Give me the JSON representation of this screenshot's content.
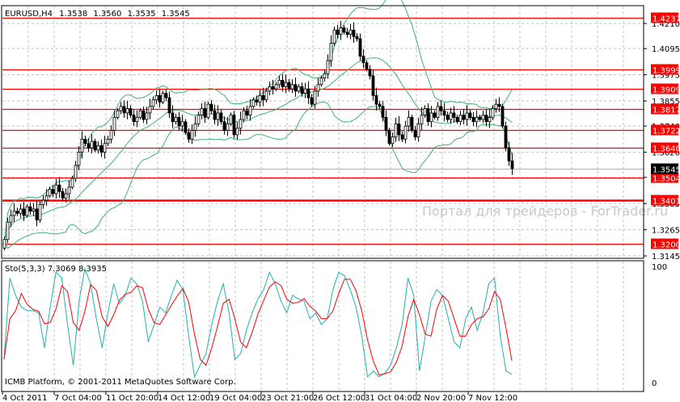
{
  "header": {
    "symbol": "EURUSD,H4",
    "open": "1.3538",
    "high": "1.3560",
    "low": "1.3535",
    "close": "1.3545"
  },
  "watermark": "Портал для трейдеров - ForTrader.ru",
  "indicator_label": "Sto(5,3,3) 7.3069 8.3935",
  "copyright": "ICMB Platform, © 2001-2011 MetaQuotes Software Corp.",
  "colors": {
    "level": "#ff0000",
    "band": "#3cb371",
    "sto_main": "#20b2aa",
    "sto_signal": "#ff0000",
    "bid": "#000000",
    "grid": "#c0c0c0"
  },
  "chart_data": {
    "type": "candlestick",
    "title": "EURUSD,H4",
    "ylim": [
      1.3134,
      1.4288
    ],
    "y_ticks": [
      "1.4210",
      "1.4095",
      "1.3975",
      "1.3855",
      "1.3740",
      "1.3620",
      "1.3505",
      "1.3385",
      "1.3265",
      "1.3145"
    ],
    "x_ticks": [
      "4 Oct 2011",
      "7 Oct 04:00",
      "11 Oct 20:00",
      "14 Oct 12:00",
      "19 Oct 04:00",
      "23 Oct 21:00",
      "26 Oct 12:00",
      "31 Oct 04:00",
      "2 Nov 20:00",
      "7 Nov 12:00"
    ],
    "levels": [
      "1.4237",
      "1.3999",
      "1.3909",
      "1.3817",
      "1.3722",
      "1.3640",
      "1.3504",
      "1.3401",
      "1.3200"
    ],
    "bid": "1.3545",
    "closes": [
      1.322,
      1.33,
      1.333,
      1.335,
      1.334,
      1.336,
      1.333,
      1.337,
      1.335,
      1.336,
      1.331,
      1.338,
      1.34,
      1.342,
      1.345,
      1.343,
      1.347,
      1.344,
      1.341,
      1.343,
      1.346,
      1.35,
      1.356,
      1.362,
      1.368,
      1.366,
      1.364,
      1.367,
      1.363,
      1.365,
      1.362,
      1.366,
      1.368,
      1.372,
      1.378,
      1.381,
      1.383,
      1.38,
      1.382,
      1.379,
      1.376,
      1.378,
      1.381,
      1.377,
      1.38,
      1.383,
      1.386,
      1.388,
      1.385,
      1.389,
      1.387,
      1.38,
      1.376,
      1.378,
      1.374,
      1.376,
      1.371,
      1.368,
      1.372,
      1.375,
      1.379,
      1.382,
      1.378,
      1.384,
      1.381,
      1.377,
      1.38,
      1.376,
      1.372,
      1.375,
      1.379,
      1.37,
      1.373,
      1.377,
      1.381,
      1.379,
      1.383,
      1.386,
      1.385,
      1.388,
      1.386,
      1.39,
      1.392,
      1.391,
      1.393,
      1.395,
      1.392,
      1.394,
      1.391,
      1.393,
      1.39,
      1.392,
      1.389,
      1.391,
      1.387,
      1.384,
      1.39,
      1.393,
      1.396,
      1.398,
      1.404,
      1.412,
      1.418,
      1.416,
      1.419,
      1.417,
      1.416,
      1.418,
      1.415,
      1.414,
      1.406,
      1.403,
      1.4,
      1.397,
      1.388,
      1.384,
      1.383,
      1.378,
      1.372,
      1.366,
      1.369,
      1.375,
      1.37,
      1.368,
      1.374,
      1.378,
      1.372,
      1.369,
      1.375,
      1.379,
      1.382,
      1.376,
      1.38,
      1.378,
      1.383,
      1.381,
      1.379,
      1.377,
      1.38,
      1.378,
      1.376,
      1.379,
      1.377,
      1.38,
      1.378,
      1.376,
      1.378,
      1.377,
      1.379,
      1.376,
      1.378,
      1.382,
      1.384,
      1.383,
      1.374,
      1.364,
      1.358,
      1.3545
    ],
    "bollinger": {
      "period": 20,
      "deviation": 2
    },
    "stochastic": {
      "ylim": [
        0,
        100
      ],
      "y_ticks": [
        "100",
        "0"
      ],
      "main": [
        20,
        90,
        75,
        65,
        62,
        62,
        60,
        30,
        65,
        95,
        90,
        50,
        15,
        70,
        98,
        85,
        55,
        30,
        60,
        85,
        68,
        75,
        90,
        85,
        70,
        35,
        50,
        65,
        60,
        75,
        88,
        80,
        40,
        5,
        15,
        25,
        50,
        70,
        85,
        60,
        20,
        25,
        45,
        60,
        72,
        80,
        95,
        85,
        70,
        60,
        75,
        72,
        70,
        55,
        60,
        50,
        55,
        80,
        95,
        92,
        80,
        65,
        40,
        5,
        10,
        5,
        8,
        15,
        30,
        50,
        90,
        75,
        10,
        40,
        70,
        80,
        75,
        55,
        35,
        30,
        55,
        65,
        45,
        60,
        85,
        90,
        40,
        10,
        7
      ]
    }
  }
}
